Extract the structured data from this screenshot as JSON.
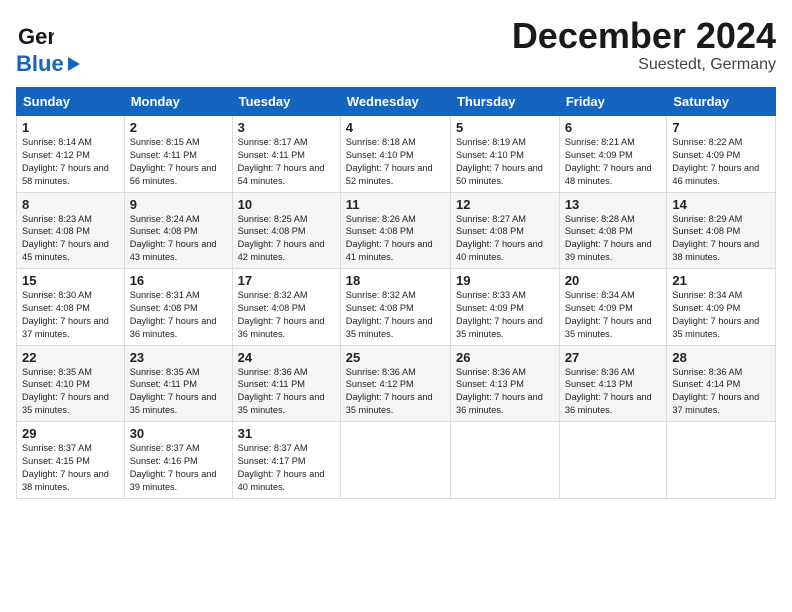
{
  "header": {
    "logo_line1": "General",
    "logo_line2": "Blue",
    "title": "December 2024",
    "subtitle": "Suestedt, Germany"
  },
  "weekdays": [
    "Sunday",
    "Monday",
    "Tuesday",
    "Wednesday",
    "Thursday",
    "Friday",
    "Saturday"
  ],
  "weeks": [
    [
      {
        "day": "1",
        "sunrise": "Sunrise: 8:14 AM",
        "sunset": "Sunset: 4:12 PM",
        "daylight": "Daylight: 7 hours and 58 minutes."
      },
      {
        "day": "2",
        "sunrise": "Sunrise: 8:15 AM",
        "sunset": "Sunset: 4:11 PM",
        "daylight": "Daylight: 7 hours and 56 minutes."
      },
      {
        "day": "3",
        "sunrise": "Sunrise: 8:17 AM",
        "sunset": "Sunset: 4:11 PM",
        "daylight": "Daylight: 7 hours and 54 minutes."
      },
      {
        "day": "4",
        "sunrise": "Sunrise: 8:18 AM",
        "sunset": "Sunset: 4:10 PM",
        "daylight": "Daylight: 7 hours and 52 minutes."
      },
      {
        "day": "5",
        "sunrise": "Sunrise: 8:19 AM",
        "sunset": "Sunset: 4:10 PM",
        "daylight": "Daylight: 7 hours and 50 minutes."
      },
      {
        "day": "6",
        "sunrise": "Sunrise: 8:21 AM",
        "sunset": "Sunset: 4:09 PM",
        "daylight": "Daylight: 7 hours and 48 minutes."
      },
      {
        "day": "7",
        "sunrise": "Sunrise: 8:22 AM",
        "sunset": "Sunset: 4:09 PM",
        "daylight": "Daylight: 7 hours and 46 minutes."
      }
    ],
    [
      {
        "day": "8",
        "sunrise": "Sunrise: 8:23 AM",
        "sunset": "Sunset: 4:08 PM",
        "daylight": "Daylight: 7 hours and 45 minutes."
      },
      {
        "day": "9",
        "sunrise": "Sunrise: 8:24 AM",
        "sunset": "Sunset: 4:08 PM",
        "daylight": "Daylight: 7 hours and 43 minutes."
      },
      {
        "day": "10",
        "sunrise": "Sunrise: 8:25 AM",
        "sunset": "Sunset: 4:08 PM",
        "daylight": "Daylight: 7 hours and 42 minutes."
      },
      {
        "day": "11",
        "sunrise": "Sunrise: 8:26 AM",
        "sunset": "Sunset: 4:08 PM",
        "daylight": "Daylight: 7 hours and 41 minutes."
      },
      {
        "day": "12",
        "sunrise": "Sunrise: 8:27 AM",
        "sunset": "Sunset: 4:08 PM",
        "daylight": "Daylight: 7 hours and 40 minutes."
      },
      {
        "day": "13",
        "sunrise": "Sunrise: 8:28 AM",
        "sunset": "Sunset: 4:08 PM",
        "daylight": "Daylight: 7 hours and 39 minutes."
      },
      {
        "day": "14",
        "sunrise": "Sunrise: 8:29 AM",
        "sunset": "Sunset: 4:08 PM",
        "daylight": "Daylight: 7 hours and 38 minutes."
      }
    ],
    [
      {
        "day": "15",
        "sunrise": "Sunrise: 8:30 AM",
        "sunset": "Sunset: 4:08 PM",
        "daylight": "Daylight: 7 hours and 37 minutes."
      },
      {
        "day": "16",
        "sunrise": "Sunrise: 8:31 AM",
        "sunset": "Sunset: 4:08 PM",
        "daylight": "Daylight: 7 hours and 36 minutes."
      },
      {
        "day": "17",
        "sunrise": "Sunrise: 8:32 AM",
        "sunset": "Sunset: 4:08 PM",
        "daylight": "Daylight: 7 hours and 36 minutes."
      },
      {
        "day": "18",
        "sunrise": "Sunrise: 8:32 AM",
        "sunset": "Sunset: 4:08 PM",
        "daylight": "Daylight: 7 hours and 35 minutes."
      },
      {
        "day": "19",
        "sunrise": "Sunrise: 8:33 AM",
        "sunset": "Sunset: 4:09 PM",
        "daylight": "Daylight: 7 hours and 35 minutes."
      },
      {
        "day": "20",
        "sunrise": "Sunrise: 8:34 AM",
        "sunset": "Sunset: 4:09 PM",
        "daylight": "Daylight: 7 hours and 35 minutes."
      },
      {
        "day": "21",
        "sunrise": "Sunrise: 8:34 AM",
        "sunset": "Sunset: 4:09 PM",
        "daylight": "Daylight: 7 hours and 35 minutes."
      }
    ],
    [
      {
        "day": "22",
        "sunrise": "Sunrise: 8:35 AM",
        "sunset": "Sunset: 4:10 PM",
        "daylight": "Daylight: 7 hours and 35 minutes."
      },
      {
        "day": "23",
        "sunrise": "Sunrise: 8:35 AM",
        "sunset": "Sunset: 4:11 PM",
        "daylight": "Daylight: 7 hours and 35 minutes."
      },
      {
        "day": "24",
        "sunrise": "Sunrise: 8:36 AM",
        "sunset": "Sunset: 4:11 PM",
        "daylight": "Daylight: 7 hours and 35 minutes."
      },
      {
        "day": "25",
        "sunrise": "Sunrise: 8:36 AM",
        "sunset": "Sunset: 4:12 PM",
        "daylight": "Daylight: 7 hours and 35 minutes."
      },
      {
        "day": "26",
        "sunrise": "Sunrise: 8:36 AM",
        "sunset": "Sunset: 4:13 PM",
        "daylight": "Daylight: 7 hours and 36 minutes."
      },
      {
        "day": "27",
        "sunrise": "Sunrise: 8:36 AM",
        "sunset": "Sunset: 4:13 PM",
        "daylight": "Daylight: 7 hours and 36 minutes."
      },
      {
        "day": "28",
        "sunrise": "Sunrise: 8:36 AM",
        "sunset": "Sunset: 4:14 PM",
        "daylight": "Daylight: 7 hours and 37 minutes."
      }
    ],
    [
      {
        "day": "29",
        "sunrise": "Sunrise: 8:37 AM",
        "sunset": "Sunset: 4:15 PM",
        "daylight": "Daylight: 7 hours and 38 minutes."
      },
      {
        "day": "30",
        "sunrise": "Sunrise: 8:37 AM",
        "sunset": "Sunset: 4:16 PM",
        "daylight": "Daylight: 7 hours and 39 minutes."
      },
      {
        "day": "31",
        "sunrise": "Sunrise: 8:37 AM",
        "sunset": "Sunset: 4:17 PM",
        "daylight": "Daylight: 7 hours and 40 minutes."
      },
      null,
      null,
      null,
      null
    ]
  ]
}
